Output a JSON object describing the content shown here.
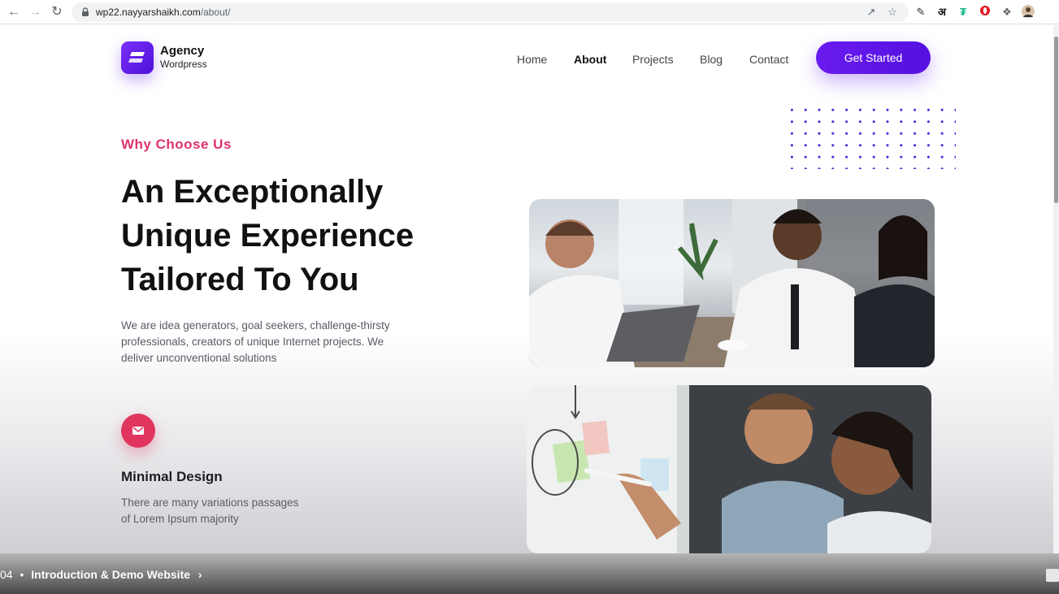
{
  "browser": {
    "url_host": "wp22.nayyarshaikh.com",
    "url_path": "/about/",
    "icons": [
      "back-icon",
      "forward-icon",
      "reload-icon",
      "lock-icon",
      "share-icon",
      "star-icon",
      "eyedropper-icon",
      "hindi-extension-icon",
      "green-extension-icon",
      "opera-icon",
      "puzzle-icon",
      "profile-avatar"
    ]
  },
  "header": {
    "logo_title": "Agency",
    "logo_subtitle": "Wordpress",
    "nav": [
      {
        "label": "Home"
      },
      {
        "label": "About"
      },
      {
        "label": "Projects"
      },
      {
        "label": "Blog"
      },
      {
        "label": "Contact"
      }
    ],
    "active_nav": "About",
    "cta_label": "Get Started"
  },
  "hero": {
    "eyebrow": "Why Choose Us",
    "headline_lines": [
      "An Exceptionally",
      "Unique Experience",
      "Tailored To You"
    ],
    "lead_lines": [
      "We are idea generators, goal seekers, challenge-thirsty",
      "professionals, creators of unique Internet projects. We",
      "deliver unconventional solutions"
    ]
  },
  "feature": {
    "icon": "mail-icon",
    "title": "Minimal Design",
    "text_lines": [
      "There are many variations passages",
      "of Lorem Ipsum majority"
    ]
  },
  "video_bar": {
    "time": "04",
    "separator": "•",
    "chapter": "Introduction & Demo Website",
    "chevron": "›"
  },
  "colors": {
    "accent_purple": "#5a12e6",
    "accent_pink": "#e0336e",
    "dot_grid": "#3b2fd6"
  }
}
